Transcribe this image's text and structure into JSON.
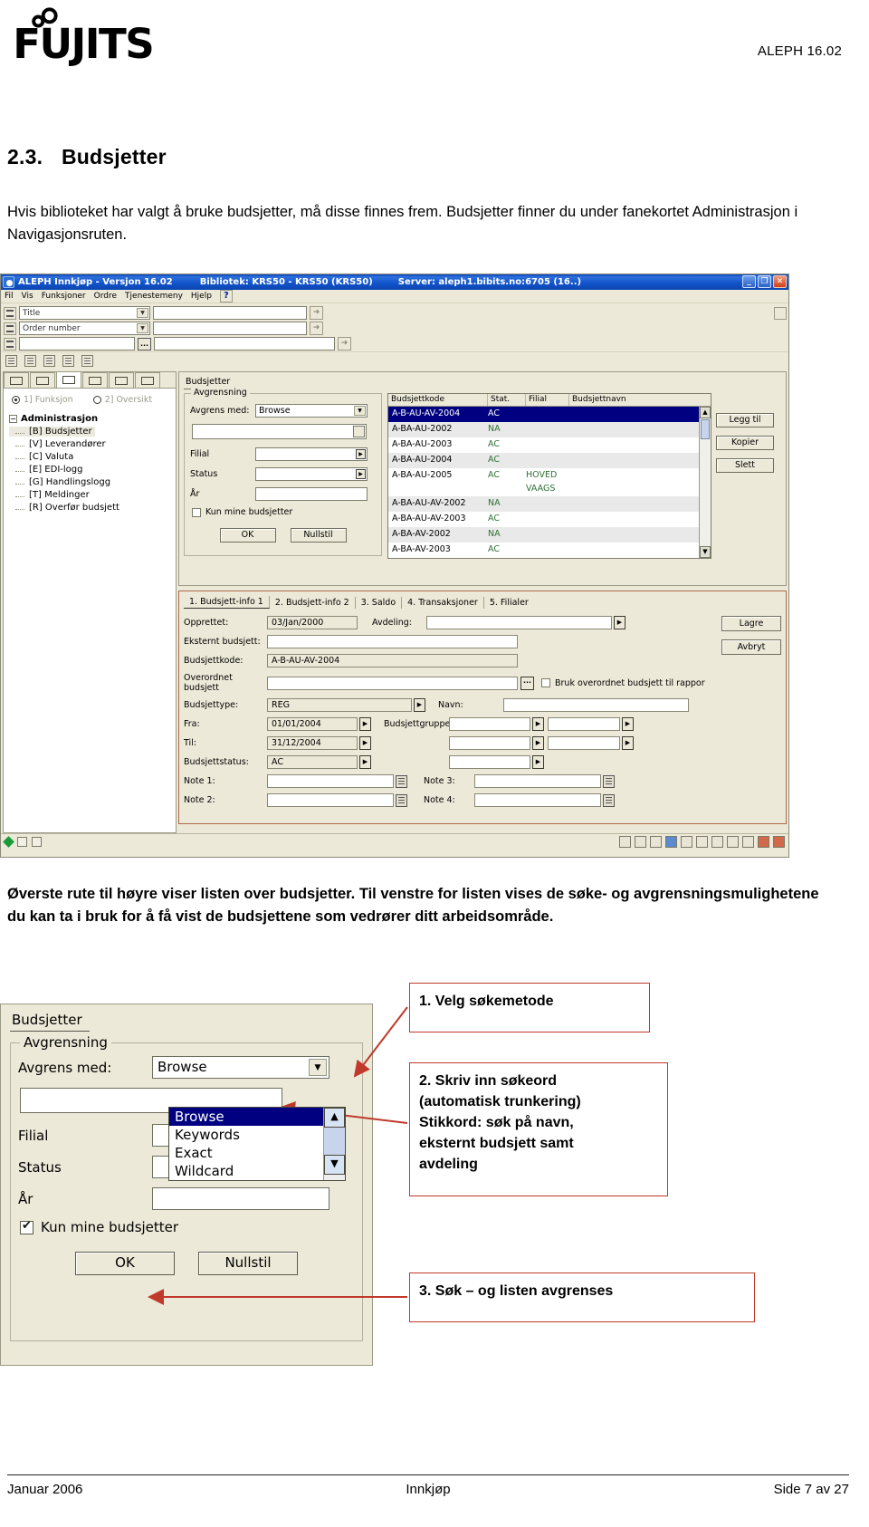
{
  "doc": {
    "logo_text": "FUJITSU",
    "version_label": "ALEPH 16.02",
    "section_number": "2.3.",
    "section_title": "Budsjetter",
    "intro": "Hvis biblioteket har valgt å bruke budsjetter, må disse finnes frem. Budsjetter finner du under fanekortet Administrasjon i Navigasjonsruten.",
    "paragraph2": "Øverste rute til høyre viser listen over budsjetter. Til venstre for listen vises de søke- og avgrensningsmulighetene du kan ta i bruk for å få vist de budsjettene som vedrører ditt arbeidsområde.",
    "footer_left": "Januar 2006",
    "footer_center": "Innkjøp",
    "footer_right": "Side 7 av 27"
  },
  "app": {
    "title": "ALEPH Innkjøp - Versjon 16.02",
    "library": "Bibliotek:  KRS50 - KRS50 (KRS50)",
    "server": "Server:  aleph1.bibits.no:6705 (16..)",
    "window_buttons": {
      "minimize": "_",
      "maximize": "❐",
      "close": "✕"
    },
    "menu": [
      "Fil",
      "Vis",
      "Funksjoner",
      "Ordre",
      "Tjenestemeny",
      "Hjelp"
    ],
    "help_button": "?",
    "search_rows": [
      {
        "combo": "Title",
        "value": ""
      },
      {
        "combo": "Order number",
        "value": ""
      },
      {
        "combo": "",
        "value": "",
        "dots": "..."
      }
    ],
    "nav": {
      "radios": [
        {
          "label": "1] Funksjon",
          "selected": true
        },
        {
          "label": "2] Oversikt",
          "selected": false
        }
      ],
      "tree_root": "Administrasjon",
      "tree_items": [
        {
          "label": "[B] Budsjetter",
          "selected": true
        },
        {
          "label": "[V] Leverandører",
          "selected": false
        },
        {
          "label": "[C] Valuta",
          "selected": false
        },
        {
          "label": "[E] EDI-logg",
          "selected": false
        },
        {
          "label": "[G] Handlingslogg",
          "selected": false
        },
        {
          "label": "[T] Meldinger",
          "selected": false
        },
        {
          "label": "[R] Overfør budsjett",
          "selected": false
        }
      ]
    },
    "budget_panel": {
      "tab_label": "Budsjetter",
      "group_label": "Avgrensning",
      "avgrens_med_label": "Avgrens med:",
      "avgrens_med_value": "Browse",
      "keyword_value": "",
      "filial_label": "Filial",
      "filial_value": "",
      "status_label": "Status",
      "status_value": "",
      "aar_label": "År",
      "aar_value": "",
      "checkbox_label": "Kun mine budsjetter",
      "checkbox_checked": false,
      "ok_label": "OK",
      "nullstil_label": "Nullstil"
    },
    "budget_list": {
      "columns": [
        "Budsjettkode",
        "Stat.",
        "Filial",
        "Budsjettnavn"
      ],
      "rows": [
        {
          "code": "A-B-AU-AV-2004",
          "stat": "AC",
          "filial": "",
          "navn": "",
          "selected": true
        },
        {
          "code": "A-BA-AU-2002",
          "stat": "NA",
          "filial": "",
          "navn": ""
        },
        {
          "code": "A-BA-AU-2003",
          "stat": "AC",
          "filial": "",
          "navn": ""
        },
        {
          "code": "A-BA-AU-2004",
          "stat": "AC",
          "filial": "",
          "navn": ""
        },
        {
          "code": "A-BA-AU-2005",
          "stat": "AC",
          "filial": "HOVED\nVAAGS",
          "navn": ""
        },
        {
          "code": "A-BA-AU-AV-2002",
          "stat": "NA",
          "filial": "",
          "navn": ""
        },
        {
          "code": "A-BA-AU-AV-2003",
          "stat": "AC",
          "filial": "",
          "navn": ""
        },
        {
          "code": "A-BA-AV-2002",
          "stat": "NA",
          "filial": "",
          "navn": ""
        },
        {
          "code": "A-BA-AV-2003",
          "stat": "AC",
          "filial": "",
          "navn": ""
        }
      ],
      "buttons": [
        "Legg til",
        "Kopier",
        "Slett"
      ]
    },
    "notebook": {
      "tabs": [
        "1. Budsjett-info 1",
        "2. Budsjett-info 2",
        "3. Saldo",
        "4. Transaksjoner",
        "5. Filialer"
      ],
      "active_tab_index": 0,
      "fields": {
        "opprettet_label": "Opprettet:",
        "opprettet_value": "03/Jan/2000",
        "avdeling_label": "Avdeling:",
        "avdeling_value": "",
        "eksternt_label": "Eksternt budsjett:",
        "eksternt_value": "",
        "budsjettkode_label": "Budsjettkode:",
        "budsjettkode_value": "A-B-AU-AV-2004",
        "overordnet_label": "Overordnet budsjett",
        "overordnet_value": "",
        "bruk_overordnet_label": "Bruk overordnet budsjett til rappor",
        "budsjettype_label": "Budsjettype:",
        "budsjettype_value": "REG",
        "navn_label": "Navn:",
        "navn_value": "",
        "fra_label": "Fra:",
        "fra_value": "01/01/2004",
        "budsjettgruppe_label": "Budsjettgruppe:",
        "budsjettgruppe_value": "",
        "til_label": "Til:",
        "til_value": "31/12/2004",
        "budsjettstatus_label": "Budsjettstatus:",
        "budsjettstatus_value": "AC",
        "note1_label": "Note 1:",
        "note1_value": "",
        "note2_label": "Note 2:",
        "note2_value": "",
        "note3_label": "Note 3:",
        "note3_value": "",
        "note4_label": "Note 4:",
        "note4_value": ""
      },
      "buttons": [
        "Lagre",
        "Avbryt"
      ]
    }
  },
  "zoomshot": {
    "tab_label": "Budsjetter",
    "group_label": "Avgrensning",
    "avgrens_med_label": "Avgrens med:",
    "avgrens_med_value": "Browse",
    "dropdown_options": [
      "Browse",
      "Keywords",
      "Exact",
      "Wildcard"
    ],
    "dropdown_selected": "Browse",
    "keyword_value": "",
    "filial_label": "Filial",
    "status_label": "Status",
    "aar_label": "År",
    "checkbox_label": "Kun mine budsjetter",
    "checkbox_checked": true,
    "ok_label": "OK",
    "nullstil_label": "Nullstil"
  },
  "callouts": [
    {
      "id": 1,
      "text": "1. Velg søkemetode"
    },
    {
      "id": 2,
      "text": "2. Skriv inn søkeord (automatisk trunkering) Stikkord: søk på navn, eksternt budsjett samt avdeling"
    },
    {
      "id": 3,
      "text": "3. Søk – og listen avgrenses"
    }
  ],
  "callout2_lines": [
    "2. Skriv inn søkeord",
    "(automatisk trunkering)",
    "Stikkord: søk på navn,",
    "eksternt budsjett samt",
    "avdeling"
  ],
  "colors": {
    "accent_red": "#c0392b",
    "titlebar_blue": "#0c45b0",
    "selection_blue": "#000080",
    "panel_beige": "#ece9d8",
    "status_green": "#2f6f33"
  }
}
